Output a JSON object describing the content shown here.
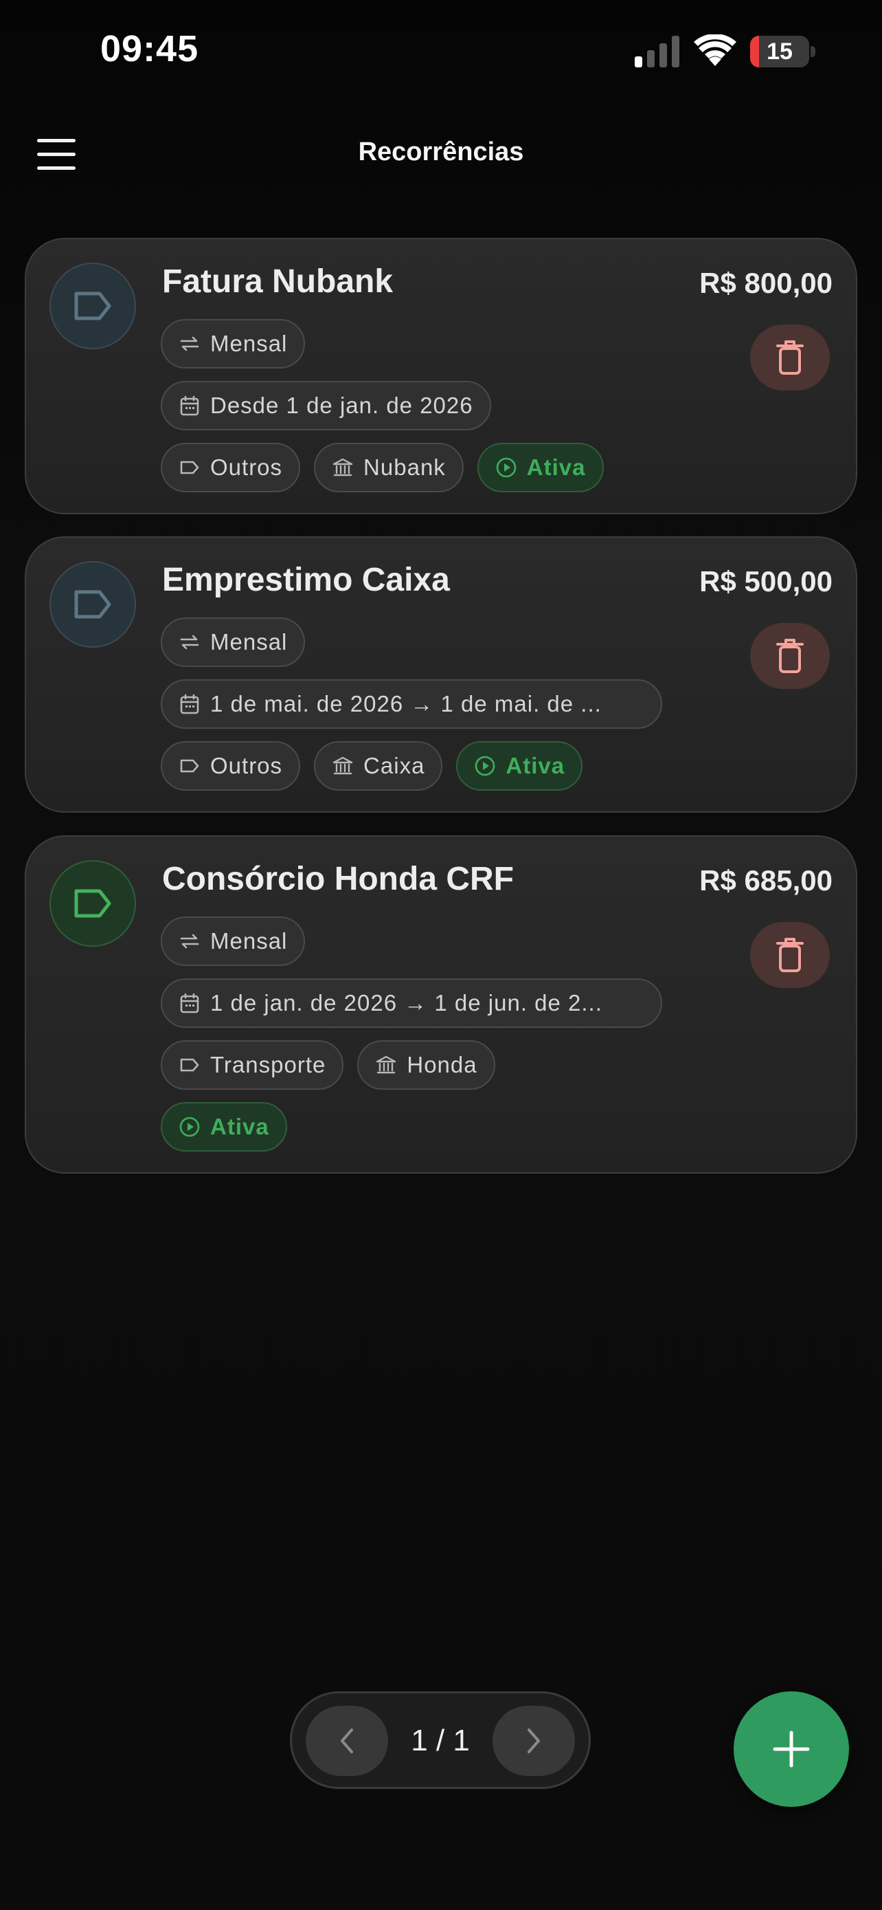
{
  "status_bar": {
    "time": "09:45",
    "battery": "15",
    "battery_level": 0.15
  },
  "header": {
    "title": "Recorrências"
  },
  "colors": {
    "accent_green": "#2f9b5e",
    "active_text": "#3fae5c",
    "delete_icon": "#f2a39c",
    "icon_gray": "#5d7684",
    "icon_green": "#44b35c"
  },
  "recurrences": [
    {
      "title": "Fatura Nubank",
      "amount": "R$ 800,00",
      "frequency": "Mensal",
      "date": "Desde 1 de jan. de 2026",
      "category": "Outros",
      "bank": "Nubank",
      "status": "Ativa",
      "icon": "tag-icon",
      "icon_color": "gray"
    },
    {
      "title": "Emprestimo Caixa",
      "amount": "R$ 500,00",
      "frequency": "Mensal",
      "date": "1 de mai. de 2026 → 1 de mai. de ...",
      "category": "Outros",
      "bank": "Caixa",
      "status": "Ativa",
      "icon": "tag-icon",
      "icon_color": "gray"
    },
    {
      "title": "Consórcio Honda CRF",
      "amount": "R$ 685,00",
      "frequency": "Mensal",
      "date": "1 de jan. de 2026 → 1 de jun. de 2...",
      "category": "Transporte",
      "bank": "Honda",
      "status": "Ativa",
      "icon": "tag-icon",
      "icon_color": "green"
    }
  ],
  "pagination": {
    "indicator": "1 / 1"
  }
}
